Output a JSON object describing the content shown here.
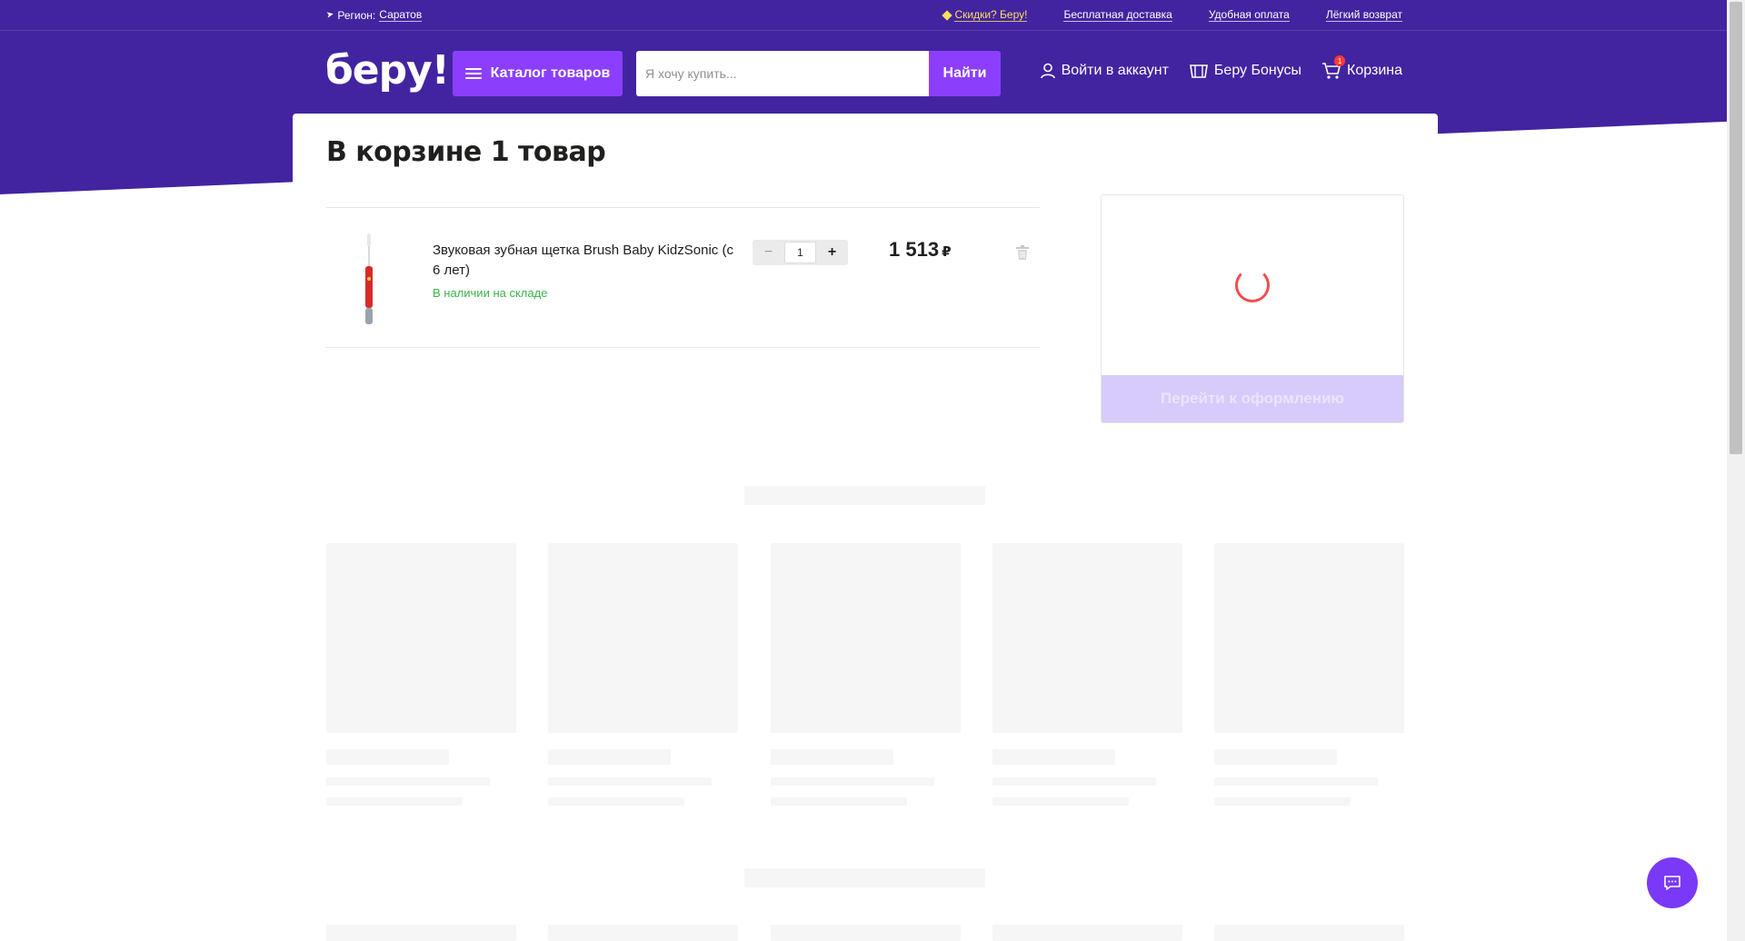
{
  "topbar": {
    "region_prefix": "Регион:",
    "region_value": "Саратов",
    "links": [
      "Скидки? Беру!",
      "Бесплатная доставка",
      "Удобная оплата",
      "Лёгкий возврат"
    ]
  },
  "header": {
    "logo": "беру!",
    "catalog_label": "Каталог товаров",
    "search_placeholder": "Я хочу купить...",
    "search_button": "Найти",
    "login_label": "Войти в аккаунт",
    "bonus_label": "Беру Бонусы",
    "cart_label": "Корзина",
    "cart_count": "1"
  },
  "cart": {
    "title": "В корзине 1 товар",
    "items": [
      {
        "name": "Звуковая зубная щетка Brush Baby KidzSonic (с 6 лет)",
        "stock": "В наличии на складе",
        "quantity": "1",
        "price": "1 513",
        "currency": "₽"
      }
    ],
    "qty_minus": "−",
    "qty_plus": "+"
  },
  "checkout": {
    "button_label": "Перейти к оформлению"
  },
  "colors": {
    "brand_purple": "#4224a0",
    "accent_purple": "#8b3ffd",
    "stock_green": "#3ab54a",
    "promo_yellow": "#ffdd60"
  }
}
